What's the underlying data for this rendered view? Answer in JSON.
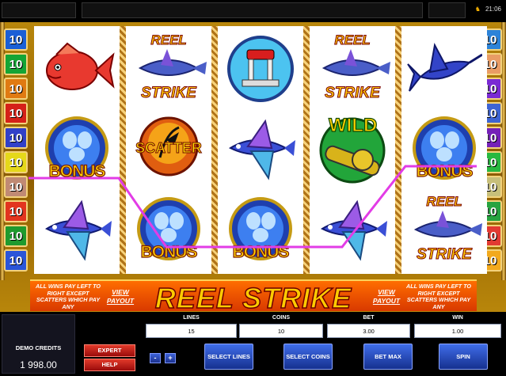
{
  "top": {
    "clock": "21:06"
  },
  "line_tiles": {
    "left": [
      {
        "value": "10",
        "color": "#1b5fd6"
      },
      {
        "value": "10",
        "color": "#14a535"
      },
      {
        "value": "10",
        "color": "#e07a12"
      },
      {
        "value": "10",
        "color": "#d52019"
      },
      {
        "value": "10",
        "color": "#3140c8"
      },
      {
        "value": "10",
        "color": "#e5d81a"
      },
      {
        "value": "10",
        "color": "#c08a74"
      },
      {
        "value": "10",
        "color": "#e2341f"
      },
      {
        "value": "10",
        "color": "#1f9a2e"
      },
      {
        "value": "10",
        "color": "#2a55d8"
      }
    ],
    "right": [
      {
        "value": "10",
        "color": "#2d83d8"
      },
      {
        "value": "10",
        "color": "#e99c65"
      },
      {
        "value": "10",
        "color": "#7a2ad3"
      },
      {
        "value": "10",
        "color": "#3e64d2"
      },
      {
        "value": "10",
        "color": "#7521b8"
      },
      {
        "value": "10",
        "color": "#28b840"
      },
      {
        "value": "10",
        "color": "#c7bf7a"
      },
      {
        "value": "10",
        "color": "#27a340"
      },
      {
        "value": "10",
        "color": "#e23a32"
      },
      {
        "value": "10",
        "color": "#f2a91d"
      }
    ]
  },
  "reels": {
    "bonus": "BONUS",
    "scatter": "SCATTER",
    "wild": "WILD",
    "reel_a": "REEL",
    "reel_b": "STRIKE"
  },
  "paytable": {
    "rules_left": "ALL WINS PAY LEFT TO RIGHT EXCEPT SCATTERS WHICH PAY ANY",
    "rules_right": "ALL WINS PAY LEFT TO RIGHT EXCEPT SCATTERS WHICH PAY ANY",
    "view_payout": "VIEW PAYOUT",
    "logo": "REEL STRIKE"
  },
  "panel": {
    "credits_label": "DEMO CREDITS",
    "credits_value": "1 998.00",
    "stats": {
      "lines": {
        "label": "LINES",
        "value": "15"
      },
      "coins": {
        "label": "COINS",
        "value": "10"
      },
      "bet": {
        "label": "BET",
        "value": "3.00"
      },
      "win": {
        "label": "WIN",
        "value": "1.00"
      }
    },
    "buttons": {
      "expert": "EXPERT",
      "help": "HELP",
      "minus": "-",
      "plus": "+",
      "select_lines": "SELECT LINES",
      "select_coins": "SELECT COINS",
      "bet_max": "BET MAX",
      "spin": "SPIN"
    }
  },
  "colors": {
    "winline": "#e23ce6",
    "paybar": "#ff6d00",
    "button_blue": "#2f55c8",
    "button_red": "#c21818"
  }
}
